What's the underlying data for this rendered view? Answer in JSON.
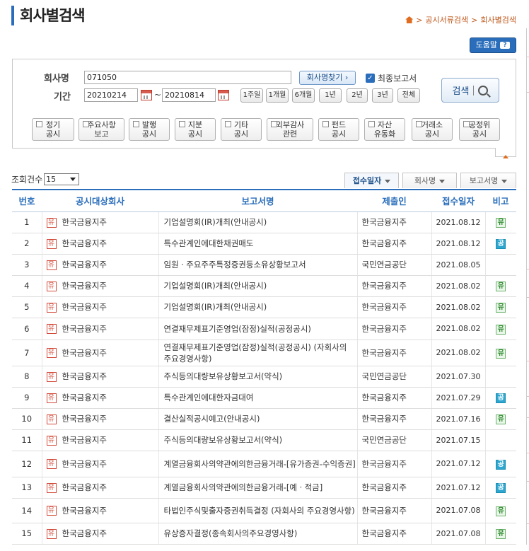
{
  "page": {
    "title": "회사별검색"
  },
  "breadcrumb": {
    "items": [
      "공시서류검색",
      "회사별검색"
    ]
  },
  "help": {
    "label": "도움말",
    "icon": "?"
  },
  "form": {
    "company_label": "회사명",
    "company_value": "071050",
    "find_button": "회사명찾기 ›",
    "final_report_label": "최종보고서",
    "final_report_checked": true,
    "period_label": "기간",
    "start_date": "20210214",
    "end_date": "20210814",
    "dash": "~",
    "period_buttons": [
      "1주일",
      "1개월",
      "6개월",
      "1년",
      "2년",
      "3년",
      "전체"
    ],
    "search_button": "검색"
  },
  "categories": [
    {
      "l1": "정기",
      "l2": "공시"
    },
    {
      "l1": "주요사항",
      "l2": "보고"
    },
    {
      "l1": "발행",
      "l2": "공시"
    },
    {
      "l1": "지분",
      "l2": "공시"
    },
    {
      "l1": "기타",
      "l2": "공시"
    },
    {
      "l1": "외부감사",
      "l2": "관련"
    },
    {
      "l1": "펀드",
      "l2": "공시"
    },
    {
      "l1": "자산",
      "l2": "유동화"
    },
    {
      "l1": "거래소",
      "l2": "공시"
    },
    {
      "l1": "공정위",
      "l2": "공시"
    }
  ],
  "results": {
    "count_label": "조회건수",
    "count_value": "15",
    "sort_buttons": [
      "접수일자",
      "회사명",
      "보고서명"
    ],
    "columns": [
      "번호",
      "공시대상회사",
      "보고서명",
      "제출인",
      "접수일자",
      "비고"
    ],
    "rows": [
      {
        "no": "1",
        "tag": "유",
        "company": "한국금융지주",
        "report": "기업설명회(IR)개최(안내공시)",
        "submitter": "한국금융지주",
        "date": "2021.08.12",
        "note": "유",
        "note_type": "g"
      },
      {
        "no": "2",
        "tag": "유",
        "company": "한국금융지주",
        "report": "특수관계인에대한채권매도",
        "submitter": "한국금융지주",
        "date": "2021.08.12",
        "note": "공",
        "note_type": "c"
      },
      {
        "no": "3",
        "tag": "유",
        "company": "한국금융지주",
        "report": "임원ㆍ주요주주특정증권등소유상황보고서",
        "submitter": "국민연금공단",
        "date": "2021.08.05",
        "note": "",
        "note_type": ""
      },
      {
        "no": "4",
        "tag": "유",
        "company": "한국금융지주",
        "report": "기업설명회(IR)개최(안내공시)",
        "submitter": "한국금융지주",
        "date": "2021.08.02",
        "note": "유",
        "note_type": "g"
      },
      {
        "no": "5",
        "tag": "유",
        "company": "한국금융지주",
        "report": "기업설명회(IR)개최(안내공시)",
        "submitter": "한국금융지주",
        "date": "2021.08.02",
        "note": "유",
        "note_type": "g"
      },
      {
        "no": "6",
        "tag": "유",
        "company": "한국금융지주",
        "report": "연결재무제표기준영업(잠정)실적(공정공시)",
        "submitter": "한국금융지주",
        "date": "2021.08.02",
        "note": "유",
        "note_type": "g"
      },
      {
        "no": "7",
        "tag": "유",
        "company": "한국금융지주",
        "report": "연결재무제표기준영업(잠정)실적(공정공시) (자회사의 주요경영사항)",
        "submitter": "한국금융지주",
        "date": "2021.08.02",
        "note": "유",
        "note_type": "g"
      },
      {
        "no": "8",
        "tag": "유",
        "company": "한국금융지주",
        "report": "주식등의대량보유상황보고서(약식)",
        "submitter": "국민연금공단",
        "date": "2021.07.30",
        "note": "",
        "note_type": ""
      },
      {
        "no": "9",
        "tag": "유",
        "company": "한국금융지주",
        "report": "특수관계인에대한자금대여",
        "submitter": "한국금융지주",
        "date": "2021.07.29",
        "note": "공",
        "note_type": "c"
      },
      {
        "no": "10",
        "tag": "유",
        "company": "한국금융지주",
        "report": "결산실적공시예고(안내공시)",
        "submitter": "한국금융지주",
        "date": "2021.07.16",
        "note": "유",
        "note_type": "g"
      },
      {
        "no": "11",
        "tag": "유",
        "company": "한국금융지주",
        "report": "주식등의대량보유상황보고서(약식)",
        "submitter": "국민연금공단",
        "date": "2021.07.15",
        "note": "",
        "note_type": ""
      },
      {
        "no": "12",
        "tag": "유",
        "company": "한국금융지주",
        "report": "계열금융회사의약관에의한금융거래-[유가증권-수익증권]",
        "submitter": "한국금융지주",
        "date": "2021.07.12",
        "note": "공",
        "note_type": "c"
      },
      {
        "no": "13",
        "tag": "유",
        "company": "한국금융지주",
        "report": "계열금융회사의약관에의한금융거래-[예ㆍ적금]",
        "submitter": "한국금융지주",
        "date": "2021.07.12",
        "note": "공",
        "note_type": "c"
      },
      {
        "no": "14",
        "tag": "유",
        "company": "한국금융지주",
        "report": "타법인주식및출자증권취득결정 (자회사의 주요경영사항)",
        "submitter": "한국금융지주",
        "date": "2021.07.08",
        "note": "유",
        "note_type": "g"
      },
      {
        "no": "15",
        "tag": "유",
        "company": "한국금융지주",
        "report": "유상증자결정(종속회사의주요경영사항)",
        "submitter": "한국금융지주",
        "date": "2021.07.08",
        "note": "유",
        "note_type": "g"
      }
    ]
  }
}
